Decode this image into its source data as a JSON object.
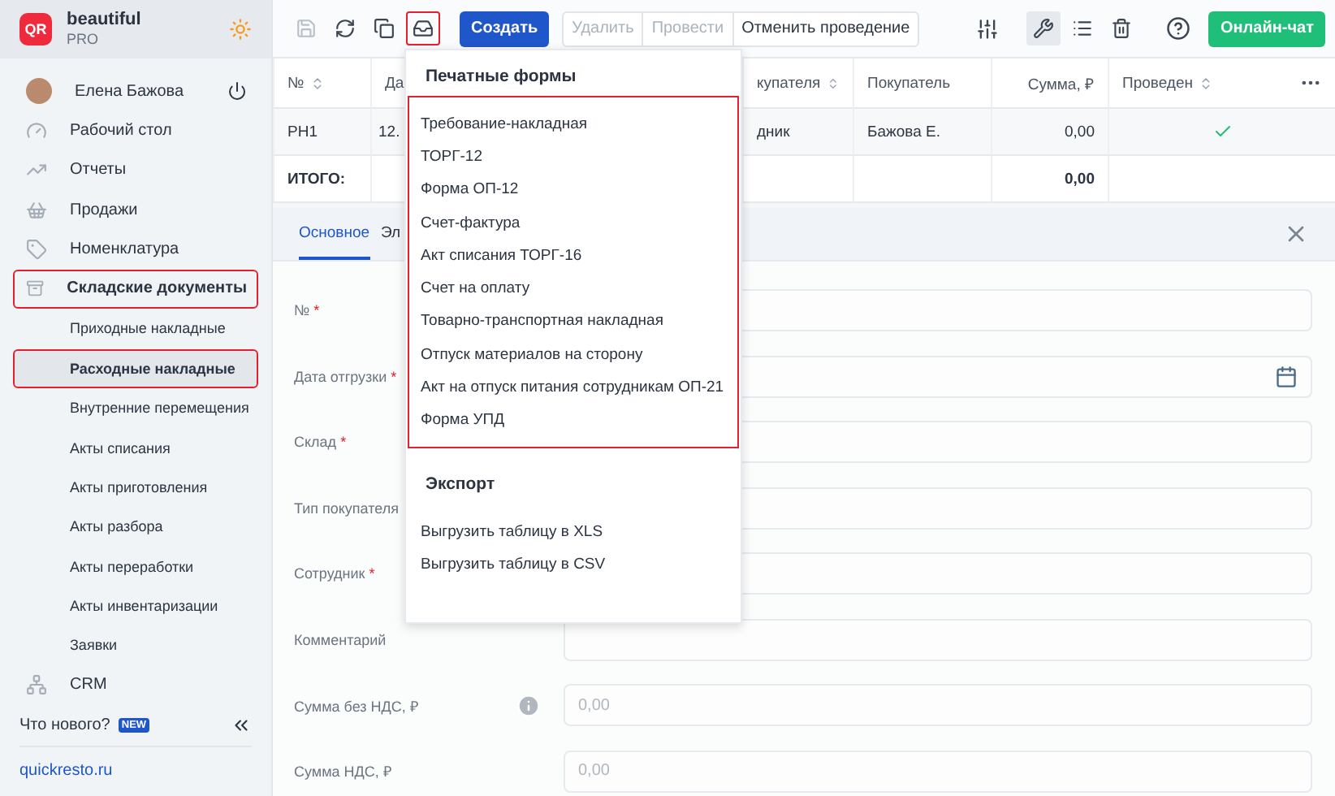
{
  "sidebar": {
    "brand": {
      "logo": "QR",
      "name": "beautiful",
      "plan": "PRO"
    },
    "user": {
      "name": "Елена Бажова"
    },
    "items": [
      {
        "kind": "section",
        "label": "Рабочий стол",
        "selected": false,
        "highlighted": false
      },
      {
        "kind": "section",
        "label": "Отчеты",
        "selected": false,
        "highlighted": false
      },
      {
        "kind": "section",
        "label": "Продажи",
        "selected": false,
        "highlighted": false
      },
      {
        "kind": "section",
        "label": "Номенклатура",
        "selected": false,
        "highlighted": false
      },
      {
        "kind": "section",
        "label": "Складские документы",
        "selected": false,
        "highlighted": true,
        "expanded": true,
        "children": [
          {
            "label": "Приходные накладные",
            "selected": false,
            "highlighted": false
          },
          {
            "label": "Расходные накладные",
            "selected": true,
            "highlighted": true
          },
          {
            "label": "Внутренние перемещения",
            "selected": false,
            "highlighted": false
          },
          {
            "label": "Акты списания",
            "selected": false,
            "highlighted": false
          },
          {
            "label": "Акты приготовления",
            "selected": false,
            "highlighted": false
          },
          {
            "label": "Акты разбора",
            "selected": false,
            "highlighted": false
          },
          {
            "label": "Акты переработки",
            "selected": false,
            "highlighted": false
          },
          {
            "label": "Акты инвентаризации",
            "selected": false,
            "highlighted": false
          },
          {
            "label": "Заявки",
            "selected": false,
            "highlighted": false
          }
        ]
      },
      {
        "kind": "section",
        "label": "CRM",
        "selected": false,
        "highlighted": false
      }
    ],
    "whats_new": "Что нового?",
    "new_badge": "NEW",
    "site_link": "quickresto.ru"
  },
  "toolbar": {
    "save_disabled": true,
    "print_highlighted": true,
    "create": "Создать",
    "actions": [
      {
        "label": "Удалить",
        "disabled": true
      },
      {
        "label": "Провести",
        "disabled": true
      },
      {
        "label": "Отменить проведение",
        "disabled": false
      }
    ],
    "tools_selected": true,
    "chat": "Онлайн-чат"
  },
  "table": {
    "columns": [
      {
        "label": "№",
        "sortable": true
      },
      {
        "label": "Да"
      },
      {
        "label": "купателя",
        "sortable": true
      },
      {
        "label": "Покупатель",
        "sortable": false
      },
      {
        "label": "Сумма, ₽",
        "sortable": false
      },
      {
        "label": "Проведен",
        "sortable": true
      }
    ],
    "rows": [
      {
        "cells": [
          "РН1",
          "12.",
          "дник",
          "Бажова Е.",
          "0,00"
        ],
        "posted": true
      }
    ],
    "total": {
      "label": "ИТОГО:",
      "sum": "0,00"
    }
  },
  "form": {
    "tabs": [
      {
        "label": "Основное",
        "selected": true
      },
      {
        "label": "Эл",
        "selected": false
      }
    ],
    "fields": [
      {
        "label": "№",
        "required_mark": "*",
        "kind": "text"
      },
      {
        "label": "Дата отгрузки",
        "required_mark": "*",
        "kind": "date"
      },
      {
        "label": "Склад",
        "required_mark": "*",
        "kind": "text"
      },
      {
        "label": "Тип покупателя",
        "kind": "text"
      },
      {
        "label": "Сотрудник",
        "required_mark": "*",
        "kind": "text"
      },
      {
        "label": "Комментарий",
        "kind": "text"
      },
      {
        "label": "Сумма без НДС, ₽",
        "kind": "text",
        "info": true,
        "placeholder": "0,00"
      },
      {
        "label": "Сумма НДС, ₽",
        "kind": "text",
        "placeholder": "0,00"
      }
    ]
  },
  "dropdown": {
    "sections": [
      {
        "title": "Печатные формы",
        "highlighted": true,
        "items": [
          "Требование-накладная",
          "ТОРГ-12",
          "Форма ОП-12",
          "Счет-фактура",
          "Акт списания ТОРГ-16",
          "Счет на оплату",
          "Товарно-транспортная накладная",
          "Отпуск материалов на сторону",
          "Акт на отпуск питания сотрудникам ОП-21",
          "Форма УПД"
        ]
      },
      {
        "title": "Экспорт",
        "highlighted": false,
        "items": [
          "Выгрузить таблицу в XLS",
          "Выгрузить таблицу в CSV"
        ]
      }
    ]
  }
}
